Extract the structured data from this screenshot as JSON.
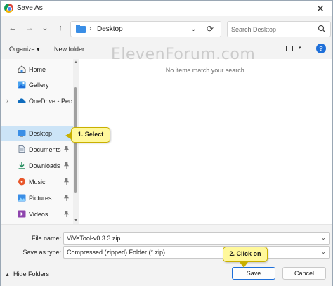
{
  "window": {
    "title": "Save As",
    "close_glyph": "✕"
  },
  "navigation": {
    "back": "←",
    "forward": "→",
    "recent": "⌄",
    "up": "↑",
    "address": {
      "separator": "›",
      "path": "Desktop",
      "dropdown": "⌄"
    },
    "refresh": "⟳",
    "search": {
      "placeholder": "Search Desktop"
    }
  },
  "toolbar": {
    "organize_label": "Organize ▾",
    "new_folder_label": "New folder",
    "view_dropdown": "▾",
    "help": "?"
  },
  "sidebar": {
    "items": [
      {
        "label": "Home",
        "icon": "home-icon",
        "pinned": false,
        "expand": ""
      },
      {
        "label": "Gallery",
        "icon": "gallery-icon",
        "pinned": false,
        "expand": ""
      },
      {
        "label": "OneDrive - Perso",
        "icon": "cloud-icon",
        "pinned": false,
        "expand": "›"
      },
      {
        "label": "Desktop",
        "icon": "desktop-icon",
        "pinned": true,
        "expand": "",
        "selected": true
      },
      {
        "label": "Documents",
        "icon": "documents-icon",
        "pinned": true,
        "expand": ""
      },
      {
        "label": "Downloads",
        "icon": "downloads-icon",
        "pinned": true,
        "expand": ""
      },
      {
        "label": "Music",
        "icon": "music-icon",
        "pinned": true,
        "expand": ""
      },
      {
        "label": "Pictures",
        "icon": "pictures-icon",
        "pinned": true,
        "expand": ""
      },
      {
        "label": "Videos",
        "icon": "videos-icon",
        "pinned": true,
        "expand": ""
      }
    ],
    "pin_glyph": "📌"
  },
  "content": {
    "empty_message": "No items match your search.",
    "watermark": "ElevenForum.com"
  },
  "form": {
    "file_name_label": "File name:",
    "file_name_value": "ViVeTool-v0.3.3.zip",
    "save_as_type_label": "Save as type:",
    "save_as_type_value": "Compressed (zipped) Folder (*.zip)",
    "dropdown_glyph": "⌄"
  },
  "footer": {
    "hide_folders_label": "Hide Folders",
    "hide_arrow": "▲",
    "save_label": "Save",
    "cancel_label": "Cancel"
  },
  "callouts": {
    "step1": "1. Select",
    "step2": "2. Click on"
  },
  "colors": {
    "accent": "#1e6fd9",
    "selected_bg": "#cce4f7",
    "callout_bg": "#fff89b",
    "folder_blue": "#3a8ee6"
  }
}
